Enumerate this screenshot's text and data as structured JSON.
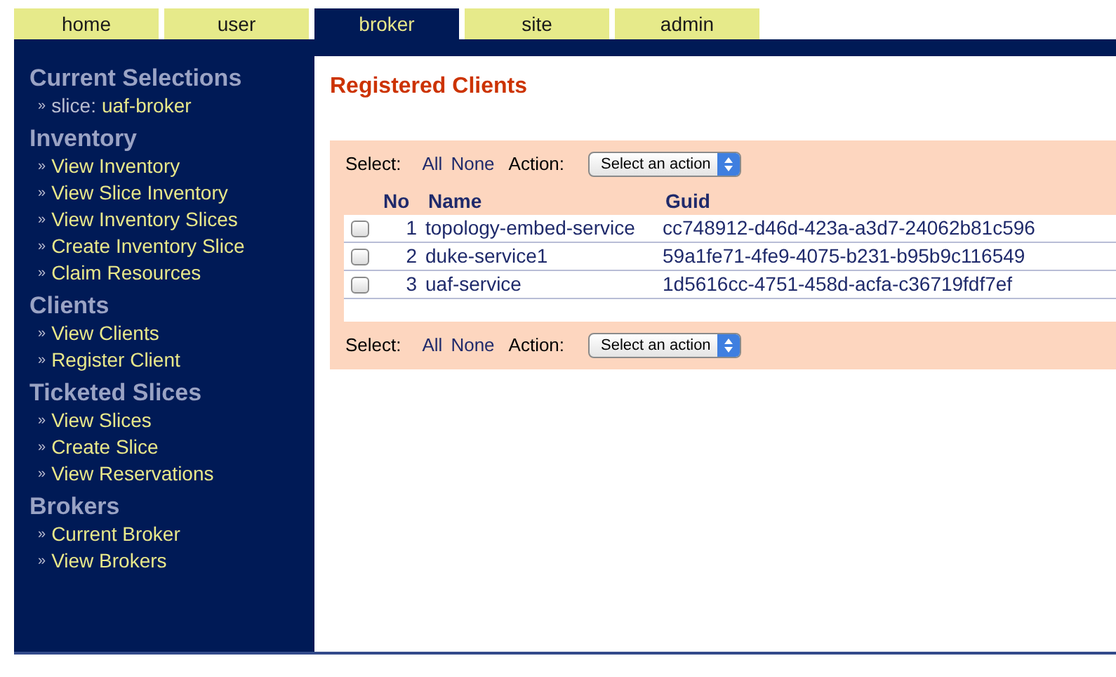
{
  "tabs": [
    {
      "label": "home",
      "selected": false
    },
    {
      "label": "user",
      "selected": false
    },
    {
      "label": "broker",
      "selected": true
    },
    {
      "label": "site",
      "selected": false
    },
    {
      "label": "admin",
      "selected": false
    }
  ],
  "sidebar": {
    "sections": [
      {
        "title": "Current Selections",
        "items": [
          {
            "bullet": "»",
            "label": "slice:",
            "value": "uaf-broker"
          }
        ]
      },
      {
        "title": "Inventory",
        "items": [
          {
            "bullet": "»",
            "label": "View Inventory"
          },
          {
            "bullet": "»",
            "label": "View Slice Inventory"
          },
          {
            "bullet": "»",
            "label": "View Inventory Slices"
          },
          {
            "bullet": "»",
            "label": "Create Inventory Slice"
          },
          {
            "bullet": "»",
            "label": "Claim Resources"
          }
        ]
      },
      {
        "title": "Clients",
        "items": [
          {
            "bullet": "»",
            "label": "View Clients"
          },
          {
            "bullet": "»",
            "label": "Register Client"
          }
        ]
      },
      {
        "title": "Ticketed Slices",
        "items": [
          {
            "bullet": "»",
            "label": "View Slices"
          },
          {
            "bullet": "»",
            "label": "Create Slice"
          },
          {
            "bullet": "»",
            "label": "View Reservations"
          }
        ]
      },
      {
        "title": "Brokers",
        "items": [
          {
            "bullet": "»",
            "label": "Current Broker"
          },
          {
            "bullet": "»",
            "label": "View Brokers"
          }
        ]
      }
    ]
  },
  "content": {
    "title": "Registered Clients",
    "toolbar_top": {
      "select_label": "Select:",
      "all": "All",
      "none": "None",
      "action_label": "Action:",
      "dropdown": "Select an action"
    },
    "table": {
      "columns": [
        "No",
        "Name",
        "Guid"
      ],
      "rows": [
        {
          "checked": false,
          "no": "1",
          "name": "topology-embed-service",
          "guid": "cc748912-d46d-423a-a3d7-24062b81c596"
        },
        {
          "checked": false,
          "no": "2",
          "name": "duke-service1",
          "guid": "59a1fe71-4fe9-4075-b231-b95b9c116549"
        },
        {
          "checked": false,
          "no": "3",
          "name": "uaf-service",
          "guid": "1d5616cc-4751-458d-acfa-c36719fdf7ef"
        }
      ]
    },
    "toolbar_bottom": {
      "select_label": "Select:",
      "all": "All",
      "none": "None",
      "action_label": "Action:",
      "dropdown": "Select an action"
    }
  }
}
